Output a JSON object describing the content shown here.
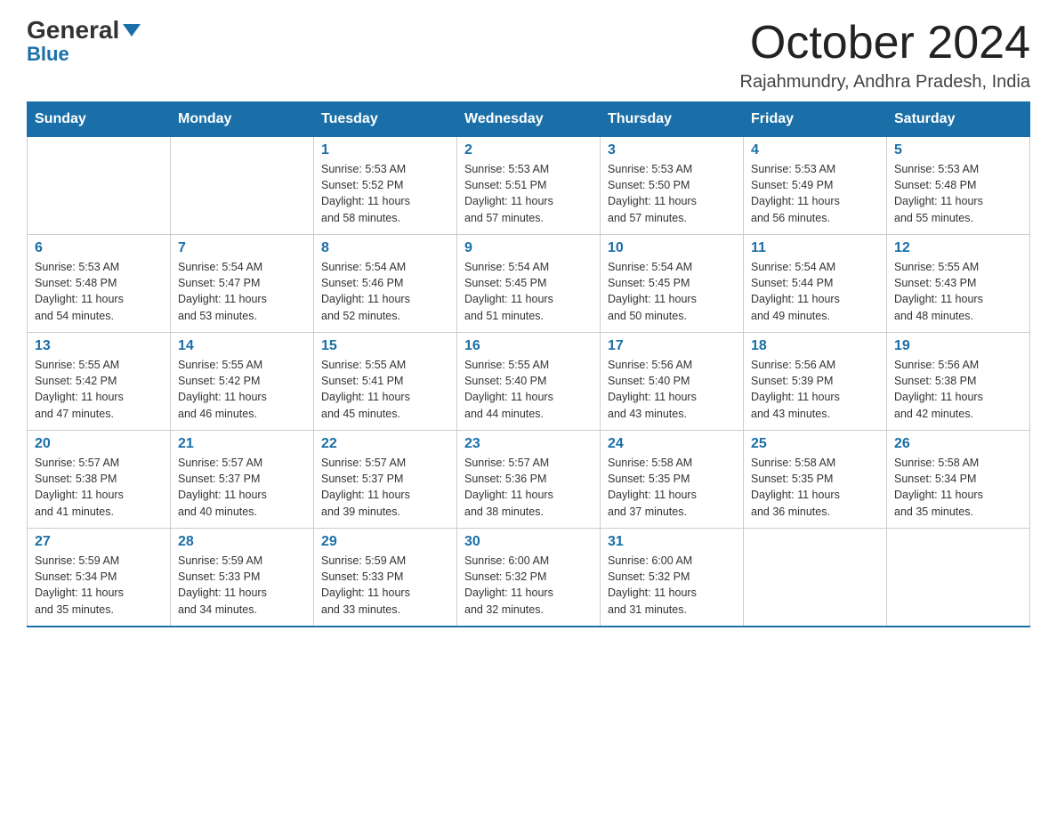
{
  "header": {
    "logo_general": "General",
    "logo_blue": "Blue",
    "month_title": "October 2024",
    "location": "Rajahmundry, Andhra Pradesh, India"
  },
  "weekdays": [
    "Sunday",
    "Monday",
    "Tuesday",
    "Wednesday",
    "Thursday",
    "Friday",
    "Saturday"
  ],
  "weeks": [
    [
      {
        "day": "",
        "info": ""
      },
      {
        "day": "",
        "info": ""
      },
      {
        "day": "1",
        "info": "Sunrise: 5:53 AM\nSunset: 5:52 PM\nDaylight: 11 hours\nand 58 minutes."
      },
      {
        "day": "2",
        "info": "Sunrise: 5:53 AM\nSunset: 5:51 PM\nDaylight: 11 hours\nand 57 minutes."
      },
      {
        "day": "3",
        "info": "Sunrise: 5:53 AM\nSunset: 5:50 PM\nDaylight: 11 hours\nand 57 minutes."
      },
      {
        "day": "4",
        "info": "Sunrise: 5:53 AM\nSunset: 5:49 PM\nDaylight: 11 hours\nand 56 minutes."
      },
      {
        "day": "5",
        "info": "Sunrise: 5:53 AM\nSunset: 5:48 PM\nDaylight: 11 hours\nand 55 minutes."
      }
    ],
    [
      {
        "day": "6",
        "info": "Sunrise: 5:53 AM\nSunset: 5:48 PM\nDaylight: 11 hours\nand 54 minutes."
      },
      {
        "day": "7",
        "info": "Sunrise: 5:54 AM\nSunset: 5:47 PM\nDaylight: 11 hours\nand 53 minutes."
      },
      {
        "day": "8",
        "info": "Sunrise: 5:54 AM\nSunset: 5:46 PM\nDaylight: 11 hours\nand 52 minutes."
      },
      {
        "day": "9",
        "info": "Sunrise: 5:54 AM\nSunset: 5:45 PM\nDaylight: 11 hours\nand 51 minutes."
      },
      {
        "day": "10",
        "info": "Sunrise: 5:54 AM\nSunset: 5:45 PM\nDaylight: 11 hours\nand 50 minutes."
      },
      {
        "day": "11",
        "info": "Sunrise: 5:54 AM\nSunset: 5:44 PM\nDaylight: 11 hours\nand 49 minutes."
      },
      {
        "day": "12",
        "info": "Sunrise: 5:55 AM\nSunset: 5:43 PM\nDaylight: 11 hours\nand 48 minutes."
      }
    ],
    [
      {
        "day": "13",
        "info": "Sunrise: 5:55 AM\nSunset: 5:42 PM\nDaylight: 11 hours\nand 47 minutes."
      },
      {
        "day": "14",
        "info": "Sunrise: 5:55 AM\nSunset: 5:42 PM\nDaylight: 11 hours\nand 46 minutes."
      },
      {
        "day": "15",
        "info": "Sunrise: 5:55 AM\nSunset: 5:41 PM\nDaylight: 11 hours\nand 45 minutes."
      },
      {
        "day": "16",
        "info": "Sunrise: 5:55 AM\nSunset: 5:40 PM\nDaylight: 11 hours\nand 44 minutes."
      },
      {
        "day": "17",
        "info": "Sunrise: 5:56 AM\nSunset: 5:40 PM\nDaylight: 11 hours\nand 43 minutes."
      },
      {
        "day": "18",
        "info": "Sunrise: 5:56 AM\nSunset: 5:39 PM\nDaylight: 11 hours\nand 43 minutes."
      },
      {
        "day": "19",
        "info": "Sunrise: 5:56 AM\nSunset: 5:38 PM\nDaylight: 11 hours\nand 42 minutes."
      }
    ],
    [
      {
        "day": "20",
        "info": "Sunrise: 5:57 AM\nSunset: 5:38 PM\nDaylight: 11 hours\nand 41 minutes."
      },
      {
        "day": "21",
        "info": "Sunrise: 5:57 AM\nSunset: 5:37 PM\nDaylight: 11 hours\nand 40 minutes."
      },
      {
        "day": "22",
        "info": "Sunrise: 5:57 AM\nSunset: 5:37 PM\nDaylight: 11 hours\nand 39 minutes."
      },
      {
        "day": "23",
        "info": "Sunrise: 5:57 AM\nSunset: 5:36 PM\nDaylight: 11 hours\nand 38 minutes."
      },
      {
        "day": "24",
        "info": "Sunrise: 5:58 AM\nSunset: 5:35 PM\nDaylight: 11 hours\nand 37 minutes."
      },
      {
        "day": "25",
        "info": "Sunrise: 5:58 AM\nSunset: 5:35 PM\nDaylight: 11 hours\nand 36 minutes."
      },
      {
        "day": "26",
        "info": "Sunrise: 5:58 AM\nSunset: 5:34 PM\nDaylight: 11 hours\nand 35 minutes."
      }
    ],
    [
      {
        "day": "27",
        "info": "Sunrise: 5:59 AM\nSunset: 5:34 PM\nDaylight: 11 hours\nand 35 minutes."
      },
      {
        "day": "28",
        "info": "Sunrise: 5:59 AM\nSunset: 5:33 PM\nDaylight: 11 hours\nand 34 minutes."
      },
      {
        "day": "29",
        "info": "Sunrise: 5:59 AM\nSunset: 5:33 PM\nDaylight: 11 hours\nand 33 minutes."
      },
      {
        "day": "30",
        "info": "Sunrise: 6:00 AM\nSunset: 5:32 PM\nDaylight: 11 hours\nand 32 minutes."
      },
      {
        "day": "31",
        "info": "Sunrise: 6:00 AM\nSunset: 5:32 PM\nDaylight: 11 hours\nand 31 minutes."
      },
      {
        "day": "",
        "info": ""
      },
      {
        "day": "",
        "info": ""
      }
    ]
  ]
}
